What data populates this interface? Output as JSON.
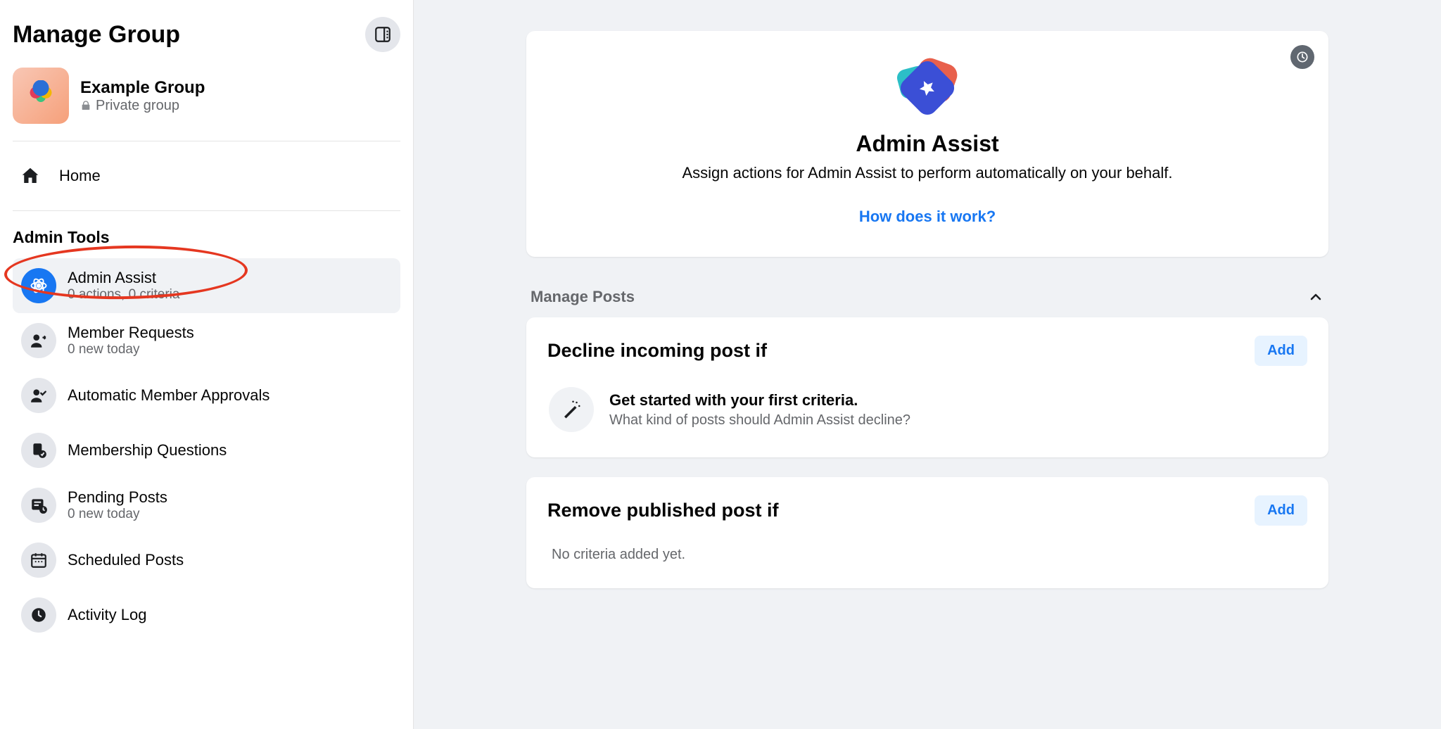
{
  "sidebar": {
    "title": "Manage Group",
    "group": {
      "name": "Example Group",
      "privacy": "Private group"
    },
    "home_label": "Home",
    "section_heading": "Admin Tools",
    "tools": [
      {
        "label": "Admin Assist",
        "sub": "0 actions, 0 criteria",
        "selected": true,
        "icon": "admin-assist"
      },
      {
        "label": "Member Requests",
        "sub": "0 new today",
        "icon": "member-requests"
      },
      {
        "label": "Automatic Member Approvals",
        "sub": "",
        "icon": "auto-approvals"
      },
      {
        "label": "Membership Questions",
        "sub": "",
        "icon": "membership-questions"
      },
      {
        "label": "Pending Posts",
        "sub": "0 new today",
        "icon": "pending-posts"
      },
      {
        "label": "Scheduled Posts",
        "sub": "",
        "icon": "scheduled-posts"
      },
      {
        "label": "Activity Log",
        "sub": "",
        "icon": "activity-log"
      }
    ]
  },
  "hero": {
    "title": "Admin Assist",
    "description": "Assign actions for Admin Assist to perform automatically on your behalf.",
    "link": "How does it work?"
  },
  "section": {
    "manage_posts_label": "Manage Posts"
  },
  "rules": {
    "decline": {
      "title": "Decline incoming post if",
      "add": "Add",
      "body_title": "Get started with your first criteria.",
      "body_sub": "What kind of posts should Admin Assist decline?"
    },
    "remove": {
      "title": "Remove published post if",
      "add": "Add",
      "empty": "No criteria added yet."
    }
  }
}
